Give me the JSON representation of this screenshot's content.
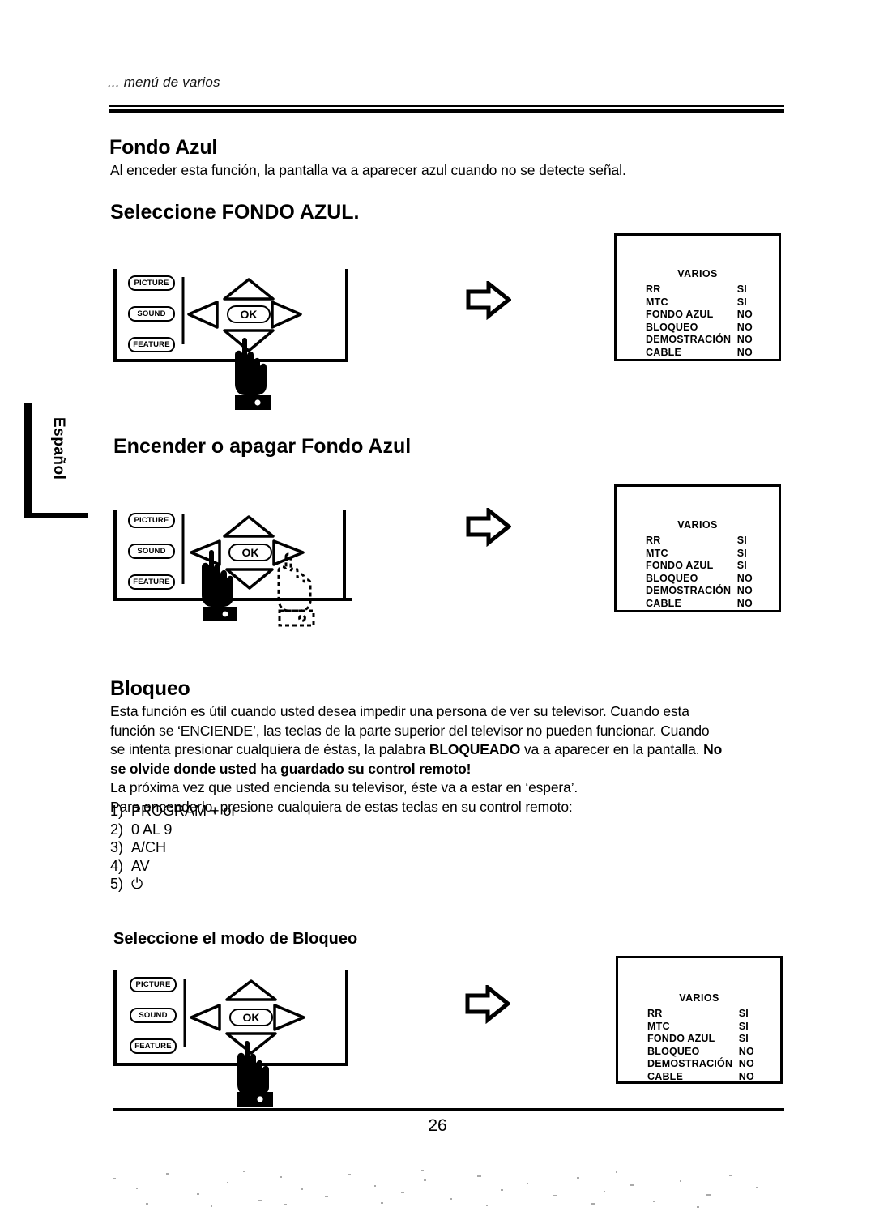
{
  "document": {
    "running_head": "... menú de varios",
    "page_number": "26",
    "language_tab": "Español"
  },
  "sections": {
    "fondo_azul": {
      "heading": "Fondo Azul",
      "intro": "Al enceder esta función, la pantalla va a aparecer azul cuando no se detecte señal.",
      "step_heading": "Seleccione  FONDO AZUL.",
      "toggle_heading": "Encender o apagar Fondo Azul"
    },
    "bloqueo": {
      "heading": "Bloqueo",
      "paragraph_line1": "Esta función es útil cuando usted desea impedir una persona de ver su televisor.  Cuando esta",
      "paragraph_line2": "función se ‘ENCIENDE’, las teclas de la parte superior del televisor no pueden funcionar.  Cuando",
      "paragraph_line3_a": "se intenta presionar cualquiera de éstas, la palabra ",
      "paragraph_line3_bold": "BLOQUEADO",
      "paragraph_line3_b": " va a aparecer en la pantalla. ",
      "paragraph_line3_c": "No",
      "paragraph_line4_bold": "se olvide donde usted ha guardado su control remoto!",
      "paragraph_line5": "La próxima vez que usted encienda su televisor, éste va a estar en ‘espera’.",
      "paragraph_line6": "Para encenderlo, presione cualquiera de estas teclas en su control remoto:",
      "list": [
        {
          "num": "1)",
          "text": "PROGRAM  +  or  —"
        },
        {
          "num": "2)",
          "text": "0 AL 9"
        },
        {
          "num": "3)",
          "text": "A/CH"
        },
        {
          "num": "4)",
          "text": "AV"
        },
        {
          "num": "5)",
          "text": "⏻"
        }
      ],
      "step_heading": "Seleccione el modo de Bloqueo"
    }
  },
  "remote": {
    "buttons": [
      {
        "label": "PICTURE"
      },
      {
        "label": "SOUND"
      },
      {
        "label": "FEATURE"
      }
    ],
    "ok_label": "OK",
    "dpad": {
      "up": "up-arrow",
      "down": "down-arrow",
      "left": "left-arrow",
      "right": "right-arrow"
    }
  },
  "tv_menus": [
    {
      "id": "menu-1",
      "title": "VARIOS",
      "rows": [
        {
          "label": "RR",
          "value": "SI"
        },
        {
          "label": "MTC",
          "value": "SI"
        },
        {
          "label": "FONDO AZUL",
          "value": "NO"
        },
        {
          "label": "BLOQUEO",
          "value": "NO"
        },
        {
          "label": "DEMOSTRACIÓN",
          "value": "NO"
        },
        {
          "label": "CABLE",
          "value": "NO"
        }
      ]
    },
    {
      "id": "menu-2",
      "title": "VARIOS",
      "rows": [
        {
          "label": "RR",
          "value": "SI"
        },
        {
          "label": "MTC",
          "value": "SI"
        },
        {
          "label": "FONDO AZUL",
          "value": "SI"
        },
        {
          "label": "BLOQUEO",
          "value": "NO"
        },
        {
          "label": "DEMOSTRACIÓN",
          "value": "NO"
        },
        {
          "label": "CABLE",
          "value": "NO"
        }
      ]
    },
    {
      "id": "menu-3",
      "title": "VARIOS",
      "rows": [
        {
          "label": "RR",
          "value": "SI"
        },
        {
          "label": "MTC",
          "value": "SI"
        },
        {
          "label": "FONDO AZUL",
          "value": "SI"
        },
        {
          "label": "BLOQUEO",
          "value": "NO"
        },
        {
          "label": "DEMOSTRACIÓN",
          "value": "NO"
        },
        {
          "label": "CABLE",
          "value": "NO"
        }
      ]
    }
  ],
  "colors": {
    "ink": "#000000",
    "paper": "#ffffff"
  }
}
